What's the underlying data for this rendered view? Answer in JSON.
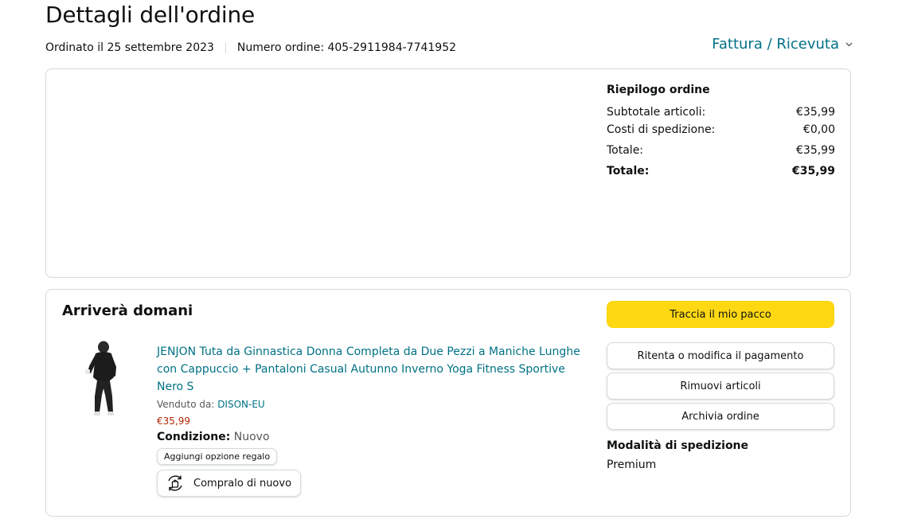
{
  "header": {
    "title": "Dettagli dell'ordine",
    "ordered_date": "Ordinato il 25 settembre 2023",
    "order_number": "Numero ordine: 405-2911984-7741952",
    "invoice_link": "Fattura / Ricevuta"
  },
  "summary": {
    "heading": "Riepilogo ordine",
    "rows": [
      {
        "label": "Subtotale articoli:",
        "value": "€35,99"
      },
      {
        "label": "Costi di spedizione:",
        "value": "€0,00"
      },
      {
        "label": "Totale:",
        "value": "€35,99"
      },
      {
        "label": "Totale:",
        "value": "€35,99"
      }
    ]
  },
  "shipment": {
    "arrival": "Arriverà domani",
    "product": {
      "title": "JENJON Tuta da Ginnastica Donna Completa da Due Pezzi a Maniche Lunghe con Cappuccio + Pantaloni Casual Autunno Inverno Yoga Fitness Sportive Nero S",
      "sold_by_label": "Venduto da: ",
      "seller": "DISON-EU",
      "price": "€35,99",
      "condition_label": "Condizione:",
      "condition_value": " Nuovo",
      "gift_button": "Aggiungi opzione regalo",
      "buy_again_button": "Compralo di nuovo"
    },
    "actions": {
      "track": "Traccia il mio pacco",
      "retry_payment": "Ritenta o modifica il pagamento",
      "remove_items": "Rimuovi articoli",
      "archive": "Archivia ordine"
    },
    "shipping_method_title": "Modalità di spedizione",
    "shipping_method_value": "Premium"
  },
  "colors": {
    "link": "#007185",
    "price": "#b12704",
    "primary_button": "#ffd814",
    "border": "#d5d9d9"
  },
  "icons": {
    "invoice_chevron": "chevron-down-icon",
    "buy_again": "buy-again-icon"
  }
}
